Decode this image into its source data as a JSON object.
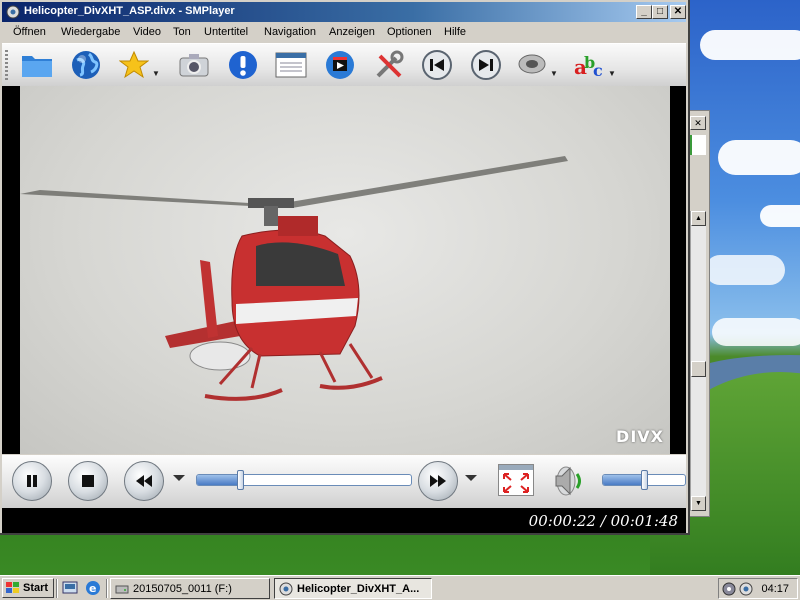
{
  "window": {
    "title": "Helicopter_DivXHT_ASP.divx - SMPlayer",
    "minimize": "_",
    "maximize": "□",
    "close": "✕"
  },
  "menu": [
    {
      "label": "Öffnen"
    },
    {
      "label": "Wiedergabe"
    },
    {
      "label": "Video"
    },
    {
      "label": "Ton"
    },
    {
      "label": "Untertitel"
    },
    {
      "label": "Navigation"
    },
    {
      "label": "Anzeigen"
    },
    {
      "label": "Optionen"
    },
    {
      "label": "Hilfe"
    }
  ],
  "toolbar_icons": [
    "folder-icon",
    "globe-icon",
    "star-icon",
    "camera-icon",
    "info-icon",
    "playlist-icon",
    "video-clip-icon",
    "tools-icon",
    "previous-icon",
    "next-icon",
    "audio-icon",
    "subtitle-abc-icon"
  ],
  "video": {
    "watermark": "DIVX"
  },
  "playback": {
    "time": "00:00:22 / 00:01:48",
    "progress": 0.204,
    "volume": 0.5
  },
  "taskbar": {
    "start": "Start",
    "tasks": [
      {
        "label": "20150705_0011 (F:)"
      },
      {
        "label": "Helicopter_DivXHT_A..."
      }
    ],
    "clock": "04:17"
  },
  "colors": {
    "title_start": "#0a246a",
    "title_end": "#a6caf0",
    "slider_fill": "#4a7bc4",
    "window_face": "#d4d0c8"
  }
}
